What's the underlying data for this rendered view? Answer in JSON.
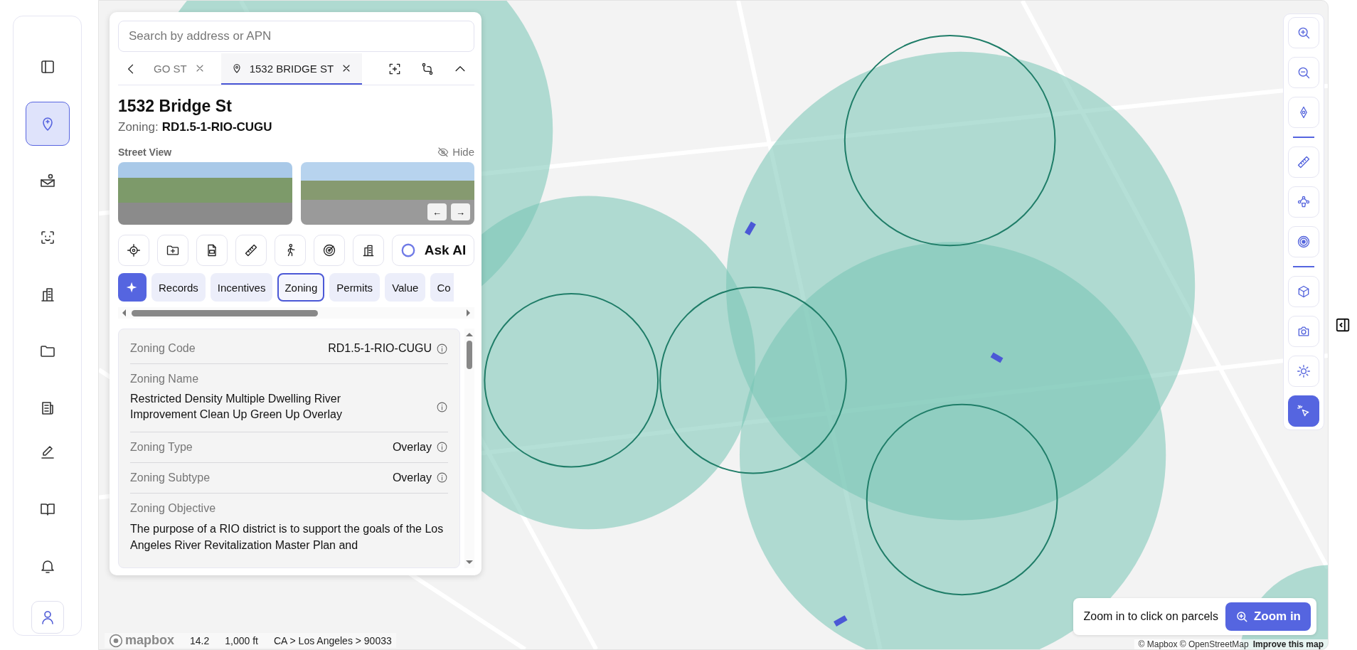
{
  "sidebar": {
    "items": [
      {
        "kind": "panel",
        "selected": false
      },
      {
        "kind": "pin",
        "selected": true
      },
      {
        "kind": "mail",
        "selected": false
      },
      {
        "kind": "face",
        "selected": false
      },
      {
        "kind": "building",
        "selected": false
      },
      {
        "kind": "folder",
        "selected": false
      },
      {
        "kind": "report",
        "selected": false
      }
    ],
    "bottom_items": [
      {
        "kind": "pencil",
        "selected": false
      },
      {
        "kind": "book",
        "selected": false
      },
      {
        "kind": "bell",
        "selected": false
      },
      {
        "kind": "user",
        "selected": false
      }
    ]
  },
  "search": {
    "placeholder": "Search by address or APN"
  },
  "tabs": [
    {
      "label": "GO ST",
      "selected": false
    },
    {
      "label": "1532 BRIDGE ST",
      "selected": true
    }
  ],
  "property": {
    "title": "1532 Bridge St",
    "zoning_label": "Zoning:",
    "zoning_code": "RD1.5-1-RIO-CUGU"
  },
  "street_view": {
    "label": "Street View",
    "hide": "Hide",
    "prev": "←",
    "next": "→"
  },
  "actions": [
    {
      "kind": "target"
    },
    {
      "kind": "folder-plus"
    },
    {
      "kind": "pdf"
    },
    {
      "kind": "ruler"
    },
    {
      "kind": "walk"
    },
    {
      "kind": "radar"
    },
    {
      "kind": "building"
    }
  ],
  "ask_ai": "Ask AI",
  "categories": [
    {
      "label": "Records",
      "selected": false
    },
    {
      "label": "Incentives",
      "selected": false
    },
    {
      "label": "Zoning",
      "selected": true
    },
    {
      "label": "Permits",
      "selected": false
    },
    {
      "label": "Value",
      "selected": false
    },
    {
      "label": "Co",
      "selected": false
    }
  ],
  "details": [
    {
      "kind": "inline",
      "label": "Zoning Code",
      "value": "RD1.5-1-RIO-CUGU"
    },
    {
      "kind": "block",
      "label": "Zoning Name",
      "value": "Restricted Density Multiple Dwelling River Improvement Clean Up Green Up Overlay"
    },
    {
      "kind": "inline",
      "label": "Zoning Type",
      "value": "Overlay"
    },
    {
      "kind": "inline",
      "label": "Zoning Subtype",
      "value": "Overlay"
    },
    {
      "kind": "text",
      "label": "Zoning Objective",
      "value": "The purpose of a RIO district is to support the goals of the Los Angeles River Revitalization Master Plan and"
    }
  ],
  "map_tool_groups": [
    [
      {
        "kind": "zoom-in",
        "selected": false
      },
      {
        "kind": "zoom-out",
        "selected": false
      },
      {
        "kind": "compass",
        "selected": false
      }
    ],
    [
      {
        "kind": "ruler",
        "selected": false
      },
      {
        "kind": "nodes",
        "selected": false
      },
      {
        "kind": "record",
        "selected": false
      }
    ],
    [
      {
        "kind": "cube",
        "selected": false
      },
      {
        "kind": "camera",
        "selected": false
      },
      {
        "kind": "sun",
        "selected": false
      },
      {
        "kind": "pointer",
        "selected": true
      }
    ]
  ],
  "zoom_hint": {
    "text": "Zoom in to click on parcels",
    "button": "Zoom in"
  },
  "map_footer": {
    "logo": "mapbox",
    "zoom": "14.2",
    "scale": "1,000 ft",
    "location": "CA > Los Angeles > 90033"
  },
  "attribution": {
    "text": "© Mapbox © OpenStreetMap",
    "link": "Improve this map"
  }
}
